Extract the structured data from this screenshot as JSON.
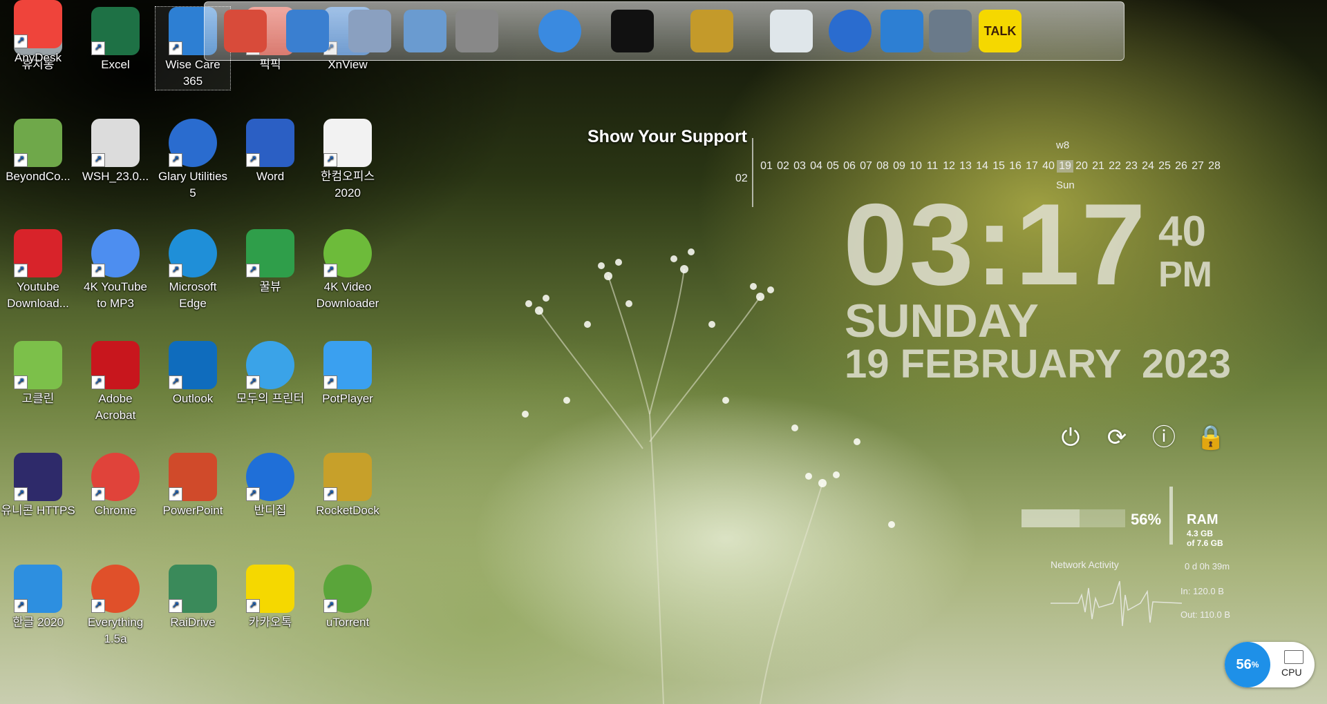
{
  "desktop_icons": [
    {
      "label": "휴지통",
      "icon": "recycle-bin-icon",
      "color": "#9aa3a8"
    },
    {
      "label": "Excel",
      "icon": "excel-icon",
      "color": "#1e7145"
    },
    {
      "label": "Wise Care 365",
      "icon": "wise-care-icon",
      "color": "#2d7fd3"
    },
    {
      "label": "픽픽",
      "icon": "picpick-icon",
      "color": "#e04b3a"
    },
    {
      "label": "XnView",
      "icon": "xnview-icon",
      "color": "#3a7fd0"
    },
    {
      "label": "BeyondCo...",
      "icon": "beyond-compare-icon",
      "color": "#6fa84a"
    },
    {
      "label": "WSH_23.0...",
      "icon": "disc-file-icon",
      "color": "#dcdcdc"
    },
    {
      "label": "Glary Utilities 5",
      "icon": "glary-utilities-icon",
      "color": "#2a6ccf"
    },
    {
      "label": "Word",
      "icon": "word-icon",
      "color": "#2b5fc4"
    },
    {
      "label": "한컴오피스 2020",
      "icon": "hancom-office-icon",
      "color": "#f2f2f2"
    },
    {
      "label": "Youtube Download...",
      "icon": "youtube-downloader-icon",
      "color": "#d8232a"
    },
    {
      "label": "4K YouTube to MP3",
      "icon": "4k-youtube-mp3-icon",
      "color": "#4d8ef0"
    },
    {
      "label": "Microsoft Edge",
      "icon": "edge-icon",
      "color": "#1f8fd8"
    },
    {
      "label": "꿀뷰",
      "icon": "honeyview-icon",
      "color": "#2f9e4a"
    },
    {
      "label": "4K Video Downloader",
      "icon": "4k-video-downloader-icon",
      "color": "#6dbb3a"
    },
    {
      "label": "고클린",
      "icon": "goclean-icon",
      "color": "#7cc04a"
    },
    {
      "label": "Adobe Acrobat",
      "icon": "adobe-acrobat-icon",
      "color": "#c8161d"
    },
    {
      "label": "Outlook",
      "icon": "outlook-icon",
      "color": "#0f6cbd"
    },
    {
      "label": "모두의 프린터",
      "icon": "printer-icon",
      "color": "#3aa3e8"
    },
    {
      "label": "PotPlayer",
      "icon": "potplayer-icon",
      "color": "#3aa0f0"
    },
    {
      "label": "유니콘 HTTPS",
      "icon": "unicorn-https-icon",
      "color": "#2e2a6a"
    },
    {
      "label": "Chrome",
      "icon": "chrome-icon",
      "color": "#e0433a"
    },
    {
      "label": "PowerPoint",
      "icon": "powerpoint-icon",
      "color": "#d04a2a"
    },
    {
      "label": "반디집",
      "icon": "bandizip-icon",
      "color": "#1f6fd8"
    },
    {
      "label": "RocketDock",
      "icon": "rocketdock-icon",
      "color": "#c7a02a"
    },
    {
      "label": "한글 2020",
      "icon": "hangul-icon",
      "color": "#2d8fe0"
    },
    {
      "label": "Everything 1.5a",
      "icon": "everything-search-icon",
      "color": "#e0502a"
    },
    {
      "label": "RaiDrive",
      "icon": "raidrive-icon",
      "color": "#3a8a5a"
    },
    {
      "label": "카카오톡",
      "icon": "kakaotalk-icon",
      "color": "#f5d800"
    },
    {
      "label": "uTorrent",
      "icon": "utorrent-icon",
      "color": "#5aa53a"
    },
    {
      "label": "AnyDesk",
      "icon": "anydesk-icon",
      "color": "#ef443b"
    }
  ],
  "dock": {
    "support_text": "Show Your Support",
    "items": [
      "picpick-dock-icon",
      "globe-dock-icon",
      "xnview-dock-icon",
      "folders-dock-icon",
      "tools-dock-icon",
      "world-globe-dock-icon",
      "tshirt-dock-icon",
      "hammer-dock-icon",
      "recycle-bin-dock-icon",
      "glary-dock-icon",
      "wise-dock-icon",
      "registry-dock-icon",
      "kakaotalk-dock-icon"
    ],
    "talk_label": "TALK"
  },
  "calendar": {
    "week": "w8",
    "month": "02",
    "days": [
      "01",
      "02",
      "03",
      "04",
      "05",
      "06",
      "07",
      "08",
      "09",
      "10",
      "11",
      "12",
      "13",
      "14",
      "15",
      "16",
      "17",
      "40",
      "19",
      "20",
      "21",
      "22",
      "23",
      "24",
      "25",
      "26",
      "27",
      "28"
    ],
    "today": "19",
    "dow": "Sun"
  },
  "clock": {
    "time": "03:17",
    "seconds": "40",
    "ampm": "PM",
    "day": "SUNDAY",
    "date": "19 FEBRUARY",
    "year": "2023"
  },
  "power_controls": [
    "power-icon",
    "restart-icon",
    "hibernate-icon",
    "lock-icon"
  ],
  "ram": {
    "percent": "56%",
    "percent_value": 56,
    "label": "RAM",
    "used": "4.3 GB",
    "total": "of 7.6 GB"
  },
  "network": {
    "title": "Network Activity",
    "uptime": "0 d 0h 39m",
    "in": "In: 120.0 B",
    "out": "Out: 110.0 B"
  },
  "cpu": {
    "percent": "56",
    "unit": "%",
    "label": "CPU",
    "color": "#1e90e8"
  }
}
